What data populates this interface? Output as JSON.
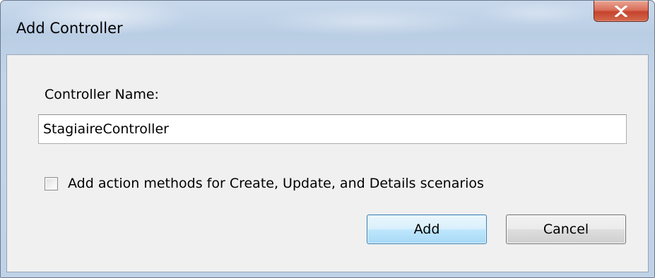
{
  "window": {
    "title": "Add Controller",
    "accent_color": "#c0d2e8",
    "close_icon": "close-x-icon"
  },
  "form": {
    "controller_name_label": "Controller Name:",
    "controller_name_value": "StagiaireController",
    "checkbox_label": "Add action methods for Create, Update, and Details scenarios",
    "checkbox_checked": false
  },
  "actions": {
    "add_label": "Add",
    "cancel_label": "Cancel"
  }
}
